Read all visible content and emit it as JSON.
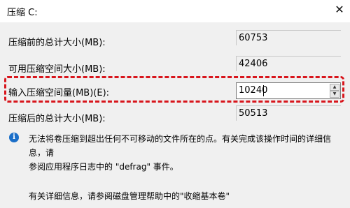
{
  "window": {
    "title": "压缩 C:",
    "close_glyph": "✕"
  },
  "fields": {
    "total_before": {
      "label": "压缩前的总计大小(MB):",
      "value": "60753"
    },
    "available": {
      "label": "可用压缩空间大小(MB):",
      "value": "42406"
    },
    "shrink_amount": {
      "label": "输入压缩空间量(MB)(E):",
      "value": "10240"
    },
    "total_after": {
      "label": "压缩后的总计大小(MB):",
      "value": "50513"
    }
  },
  "spinner": {
    "up_glyph": "▲",
    "down_glyph": "▼"
  },
  "info": {
    "icon": "i",
    "line1": "无法将卷压缩到超出任何不可移动的文件所在的点。有关完成该操作时间的详细信息，请",
    "line2": "参阅应用程序日志中的 \"defrag\" 事件。"
  },
  "footer": {
    "text": "有关详细信息，请参阅磁盘管理帮助中的\"收缩基本卷\""
  },
  "colors": {
    "highlight": "#d8151c",
    "info_icon": "#1a6ec8",
    "background": "#f0f0f0"
  }
}
